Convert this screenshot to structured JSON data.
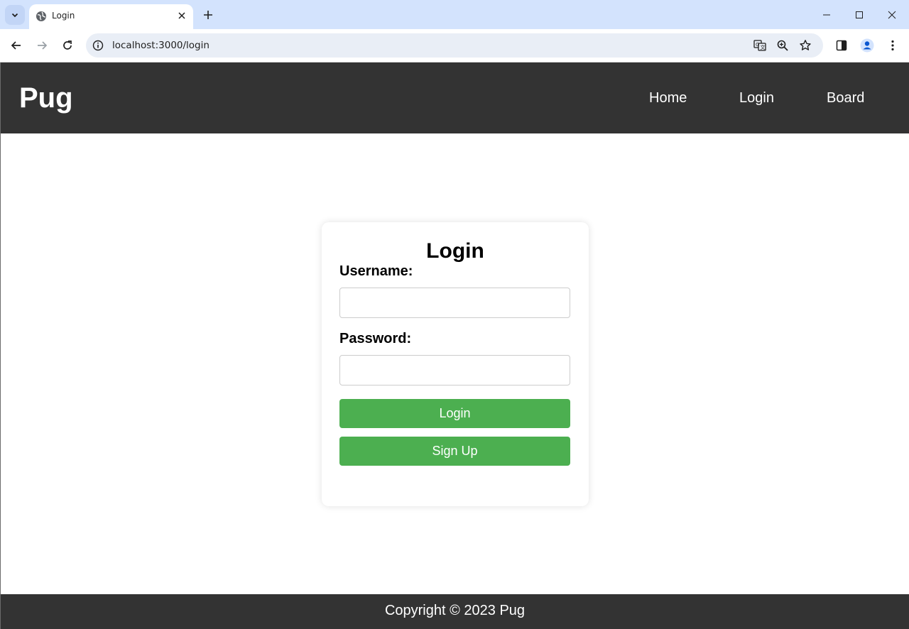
{
  "browser": {
    "tab_title": "Login",
    "url": "localhost:3000/login"
  },
  "header": {
    "brand": "Pug",
    "nav": [
      "Home",
      "Login",
      "Board"
    ]
  },
  "login_form": {
    "title": "Login",
    "username_label": "Username:",
    "username_value": "",
    "password_label": "Password:",
    "password_value": "",
    "login_button": "Login",
    "signup_button": "Sign Up"
  },
  "footer": {
    "copyright": "Copyright © 2023 Pug"
  },
  "colors": {
    "header_bg": "#333333",
    "button_green": "#4caf50",
    "tabstrip_bg": "#d3e3fd"
  }
}
